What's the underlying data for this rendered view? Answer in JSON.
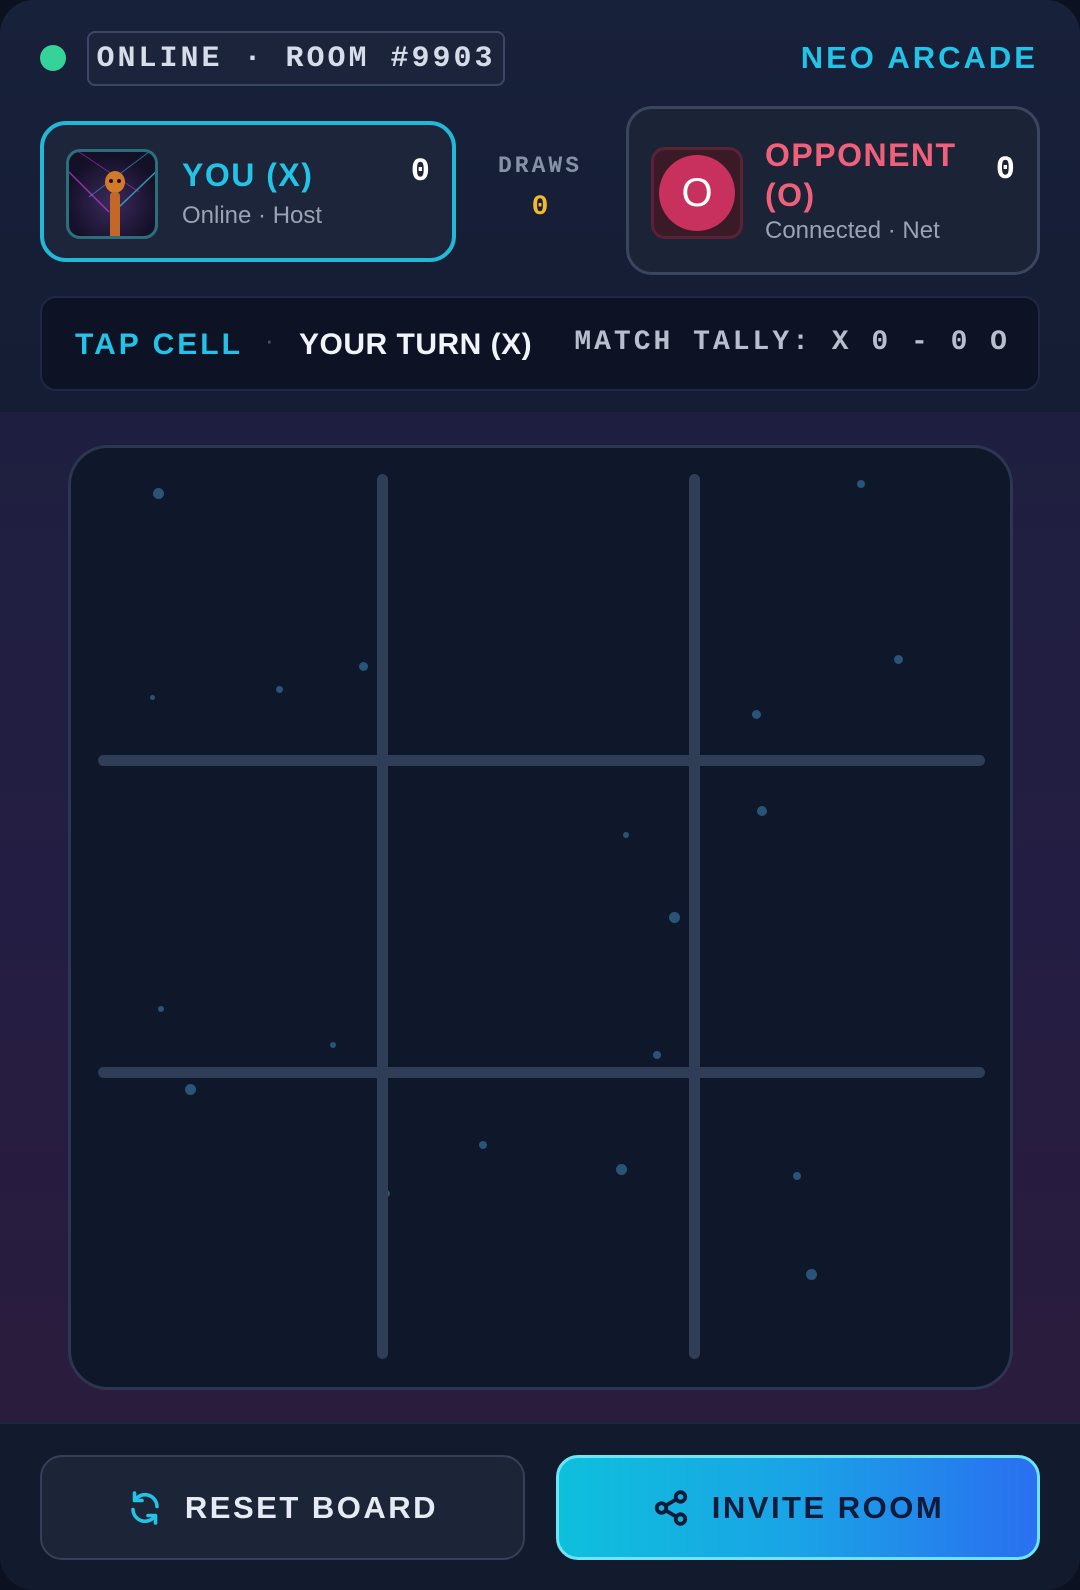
{
  "header": {
    "room_label": "ONLINE · ROOM #9903",
    "brand": "NEO ARCADE",
    "status_color": "#34d399"
  },
  "players": {
    "you": {
      "name": "YOU (X)",
      "subtitle": "Online · Host",
      "score": "0",
      "accent": "#22c3e6"
    },
    "opponent": {
      "name": "OPPONENT (O)",
      "subtitle": "Connected · Net",
      "score": "0",
      "avatar_letter": "O",
      "accent": "#f0607a"
    }
  },
  "draws": {
    "label": "DRAWS",
    "value": "0"
  },
  "status_bar": {
    "action": "TAP CELL",
    "separator": "·",
    "turn": "YOUR TURN (X)",
    "tally": "MATCH TALLY: X 0 - 0 O"
  },
  "board": {
    "cells": [
      "",
      "",
      "",
      "",
      "",
      "",
      "",
      "",
      ""
    ]
  },
  "buttons": {
    "reset": {
      "label": "RESET BOARD",
      "icon": "refresh-icon"
    },
    "invite": {
      "label": "INVITE ROOM",
      "icon": "share-icon"
    }
  }
}
